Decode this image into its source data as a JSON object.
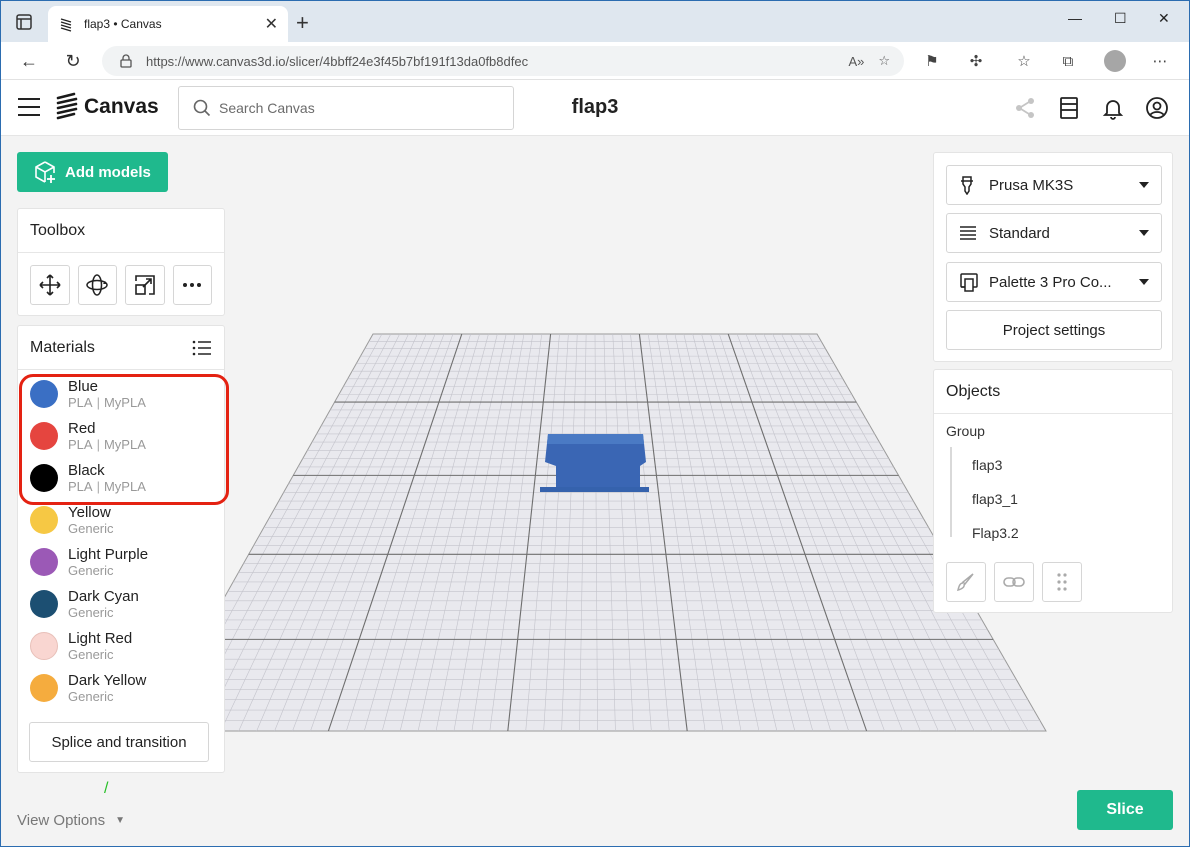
{
  "browser": {
    "tab_title": "flap3 • Canvas",
    "url": "https://www.canvas3d.io/slicer/4bbff24e3f45b7bf191f13da0fb8dfec"
  },
  "header": {
    "brand": "Canvas",
    "search_placeholder": "Search Canvas",
    "project_title": "flap3"
  },
  "left": {
    "add_models_label": "Add models",
    "toolbox_title": "Toolbox",
    "tools": [
      "move-icon",
      "rotate-icon",
      "scale-icon",
      "more-icon"
    ],
    "materials_title": "Materials",
    "materials": [
      {
        "name": "Blue",
        "type": "PLA",
        "brand": "MyPLA",
        "color": "#3a6fc4"
      },
      {
        "name": "Red",
        "type": "PLA",
        "brand": "MyPLA",
        "color": "#e5453f"
      },
      {
        "name": "Black",
        "type": "PLA",
        "brand": "MyPLA",
        "color": "#000000"
      },
      {
        "name": "Yellow",
        "type": "Generic",
        "brand": "",
        "color": "#f6c844"
      },
      {
        "name": "Light Purple",
        "type": "Generic",
        "brand": "",
        "color": "#9b59b6"
      },
      {
        "name": "Dark Cyan",
        "type": "Generic",
        "brand": "",
        "color": "#1c4f72"
      },
      {
        "name": "Light Red",
        "type": "Generic",
        "brand": "",
        "color": "#f9d6d1"
      },
      {
        "name": "Dark Yellow",
        "type": "Generic",
        "brand": "",
        "color": "#f5ac3e"
      }
    ],
    "splice_label": "Splice and transition",
    "view_options_label": "View Options"
  },
  "right": {
    "printer": "Prusa MK3S",
    "profile": "Standard",
    "device": "Palette 3 Pro Co...",
    "project_settings_label": "Project settings",
    "objects_title": "Objects",
    "group_label": "Group",
    "objects": [
      "flap3",
      "flap3_1",
      "Flap3.2"
    ]
  },
  "slice_label": "Slice",
  "colors": {
    "accent": "#1fb98d",
    "highlight": "#e42212",
    "model": "#3a66b4"
  }
}
